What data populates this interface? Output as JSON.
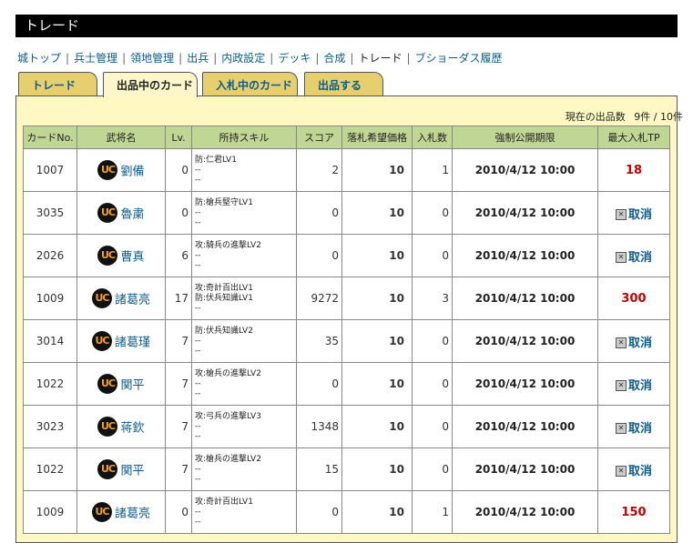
{
  "header": {
    "title": "トレード"
  },
  "nav": [
    {
      "label": "城トップ"
    },
    {
      "label": "兵士管理"
    },
    {
      "label": "領地管理"
    },
    {
      "label": "出兵"
    },
    {
      "label": "内政設定"
    },
    {
      "label": "デッキ"
    },
    {
      "label": "合成"
    },
    {
      "label": "トレード",
      "current": true
    },
    {
      "label": "ブショーダス履歴"
    }
  ],
  "tabs": [
    {
      "label": "トレード"
    },
    {
      "label": "出品中のカード",
      "active": true
    },
    {
      "label": "入札中のカード"
    },
    {
      "label": "出品する"
    }
  ],
  "listing_count": {
    "label": "現在の出品数",
    "value": "9件 / 10件"
  },
  "table": {
    "headers": [
      "カードNo.",
      "武将名",
      "Lv.",
      "所持スキル",
      "スコア",
      "落札希望価格",
      "入札数",
      "強制公開期限",
      "最大入札TP"
    ],
    "badge": "UC",
    "cancel_label": "取消",
    "rows": [
      {
        "no": "1007",
        "name": "劉備",
        "lv": "0",
        "skills": [
          "防:仁君LV1",
          "--",
          "--"
        ],
        "score": "2",
        "price": "10",
        "bids": "1",
        "deadline": "2010/4/12 10:00",
        "tp": "18"
      },
      {
        "no": "3035",
        "name": "魯粛",
        "lv": "0",
        "skills": [
          "防:槍兵堅守LV1",
          "--",
          "--"
        ],
        "score": "0",
        "price": "10",
        "bids": "0",
        "deadline": "2010/4/12 10:00",
        "tp": null
      },
      {
        "no": "2026",
        "name": "曹真",
        "lv": "6",
        "skills": [
          "攻:騎兵の進撃LV2",
          "--",
          "--"
        ],
        "score": "0",
        "price": "10",
        "bids": "0",
        "deadline": "2010/4/12 10:00",
        "tp": null
      },
      {
        "no": "1009",
        "name": "諸葛亮",
        "lv": "17",
        "skills": [
          "攻:奇計百出LV1",
          "防:伏兵知識LV1",
          "--"
        ],
        "score": "9272",
        "price": "10",
        "bids": "3",
        "deadline": "2010/4/12 10:00",
        "tp": "300"
      },
      {
        "no": "3014",
        "name": "諸葛瑾",
        "lv": "7",
        "skills": [
          "防:伏兵知識LV2",
          "--",
          "--"
        ],
        "score": "35",
        "price": "10",
        "bids": "0",
        "deadline": "2010/4/12 10:00",
        "tp": null
      },
      {
        "no": "1022",
        "name": "関平",
        "lv": "7",
        "skills": [
          "攻:槍兵の進撃LV2",
          "--",
          "--"
        ],
        "score": "0",
        "price": "10",
        "bids": "0",
        "deadline": "2010/4/12 10:00",
        "tp": null
      },
      {
        "no": "3023",
        "name": "蒋欽",
        "lv": "7",
        "skills": [
          "攻:弓兵の進撃LV3",
          "--",
          "--"
        ],
        "score": "1348",
        "price": "10",
        "bids": "0",
        "deadline": "2010/4/12 10:00",
        "tp": null
      },
      {
        "no": "1022",
        "name": "関平",
        "lv": "7",
        "skills": [
          "攻:槍兵の進撃LV2",
          "--",
          "--"
        ],
        "score": "15",
        "price": "10",
        "bids": "0",
        "deadline": "2010/4/12 10:00",
        "tp": null
      },
      {
        "no": "1009",
        "name": "諸葛亮",
        "lv": "0",
        "skills": [
          "攻:奇計百出LV1",
          "--",
          "--"
        ],
        "score": "0",
        "price": "10",
        "bids": "1",
        "deadline": "2010/4/12 10:00",
        "tp": "150"
      }
    ]
  }
}
